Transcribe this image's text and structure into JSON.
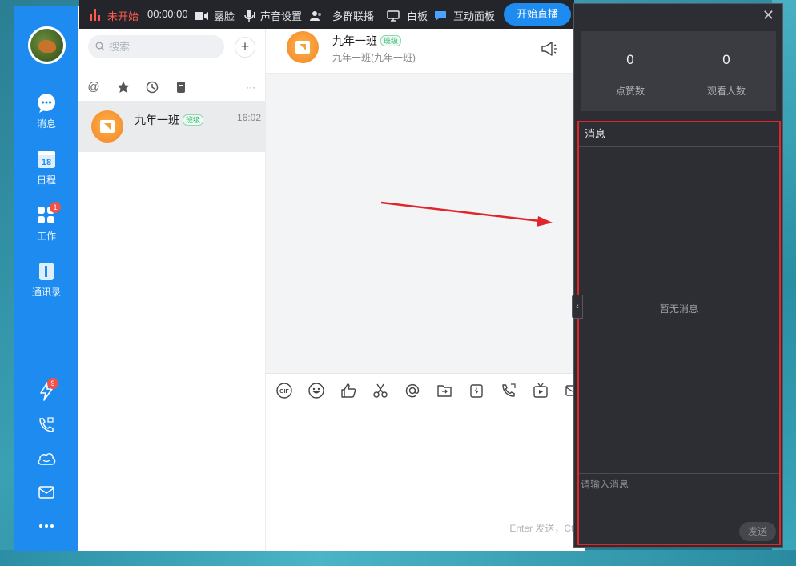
{
  "sidebar": {
    "items": [
      {
        "label": "消息",
        "icon": "chat-bubble-icon"
      },
      {
        "label": "日程",
        "icon": "calendar-icon",
        "day": "18"
      },
      {
        "label": "工作",
        "icon": "apps-grid-icon",
        "badge": "1"
      },
      {
        "label": "通讯录",
        "icon": "contacts-book-icon"
      }
    ],
    "bottom_badge": "9"
  },
  "search": {
    "placeholder": "搜索"
  },
  "conversations": [
    {
      "name": "九年一班",
      "tag": "班级",
      "time": "16:02"
    }
  ],
  "chat": {
    "title": "九年一班",
    "tag": "班级",
    "subtitle": "九年一班(九年一班)",
    "hint": "Enter 发送，Ctrl+"
  },
  "livebar": {
    "status": "未开始",
    "timer": "00:00:00",
    "face": "露脸",
    "sound": "声音设置",
    "multi": "多群联播",
    "whiteboard": "白板",
    "interactive": "互动面板",
    "start": "开始直播"
  },
  "panel": {
    "likes_value": "0",
    "likes_label": "点赞数",
    "viewers_value": "0",
    "viewers_label": "观看人数",
    "messages_title": "消息",
    "empty_text": "暂无消息",
    "input_placeholder": "请输入消息",
    "send_label": "发送"
  },
  "colors": {
    "brand_blue": "#1e8bf0",
    "live_status_red": "#ff5a4f",
    "highlight_red": "#e0262b",
    "panel_dark": "#2c2e33"
  }
}
